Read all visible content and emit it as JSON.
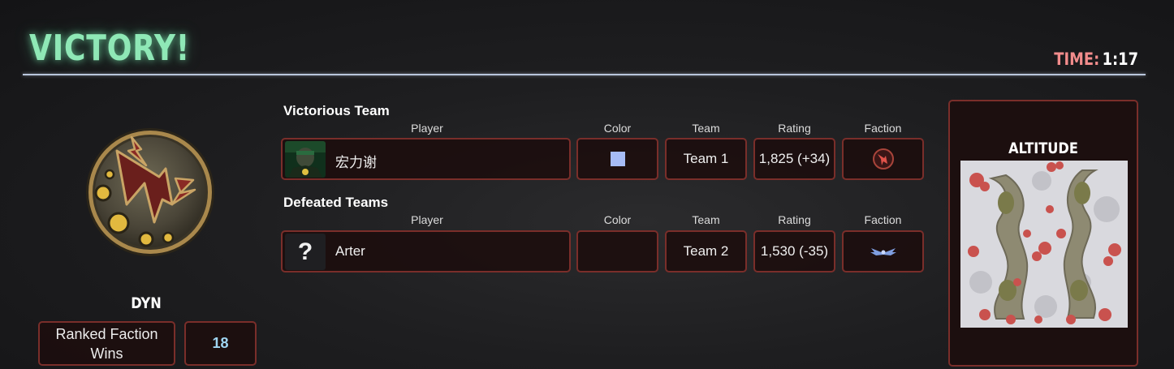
{
  "header": {
    "title": "VICTORY!",
    "time_label": "TIME:",
    "time_value": "1:17"
  },
  "player_card": {
    "badge_icon": "faction-lightning-emblem-icon",
    "name": "DYN",
    "ranked_label": "Ranked Faction Wins",
    "ranked_value": "18"
  },
  "victorious": {
    "heading": "Victorious Team",
    "columns": [
      "Player",
      "Color",
      "Team",
      "Rating",
      "Faction"
    ],
    "rows": [
      {
        "player": "宏力谢",
        "avatar_icon": "commander-portrait-icon",
        "color": "#a6bcf6",
        "team": "Team 1",
        "rating": "1,825 (+34)",
        "faction_icon": "red-faction-icon"
      }
    ]
  },
  "defeated": {
    "heading": "Defeated Teams",
    "columns": [
      "Player",
      "Color",
      "Team",
      "Rating",
      "Faction"
    ],
    "rows": [
      {
        "player": "Arter",
        "avatar_icon": "unknown-player-icon",
        "avatar_glyph": "?",
        "color": "",
        "team": "Team 2",
        "rating": "1,530 (-35)",
        "faction_icon": "blue-wings-faction-icon"
      }
    ]
  },
  "map": {
    "name": "ALTITUDE",
    "preview_icon": "minimap-preview"
  },
  "colors": {
    "title_green": "#8fe8b6",
    "time_label_red": "#f28c8c",
    "box_border": "#7a2e2a",
    "box_fill": "#1c0e0e",
    "ranked_value_blue": "#9fd5f2"
  }
}
